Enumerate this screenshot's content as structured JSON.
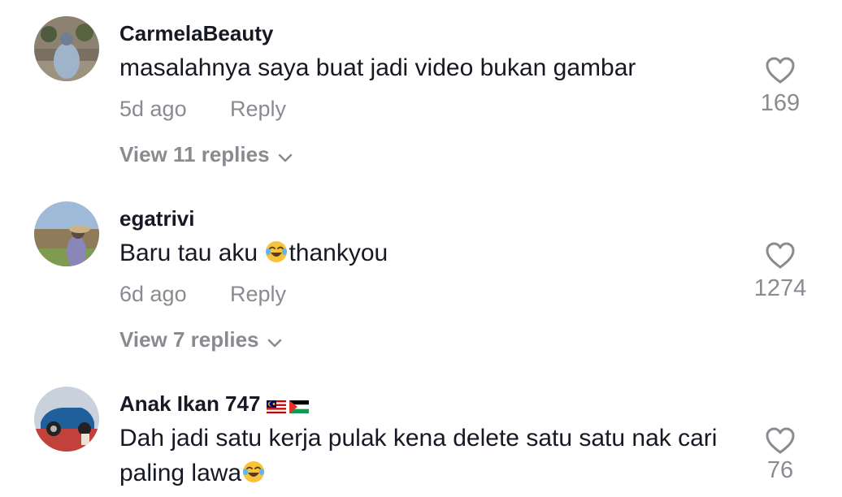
{
  "comments": [
    {
      "username": "CarmelaBeauty",
      "text": "masalahnya saya buat jadi video bukan gambar",
      "time": "5d ago",
      "reply_label": "Reply",
      "likes": "169",
      "view_replies": "View 11 replies"
    },
    {
      "username": "egatrivi",
      "text_before_emoji": "Baru tau aku ",
      "text_after_emoji": "thankyou",
      "emoji": "face-with-tears-of-joy",
      "time": "6d ago",
      "reply_label": "Reply",
      "likes": "1274",
      "view_replies": "View 7 replies"
    },
    {
      "username": "Anak Ikan 747",
      "flags": [
        "malaysia-flag",
        "palestine-flag"
      ],
      "text": "Dah jadi satu kerja pulak kena delete satu satu nak cari paling lawa",
      "emoji": "face-with-tears-of-joy",
      "likes": "76"
    }
  ],
  "colors": {
    "text_primary": "#161823",
    "text_secondary": "#8a8b91"
  }
}
